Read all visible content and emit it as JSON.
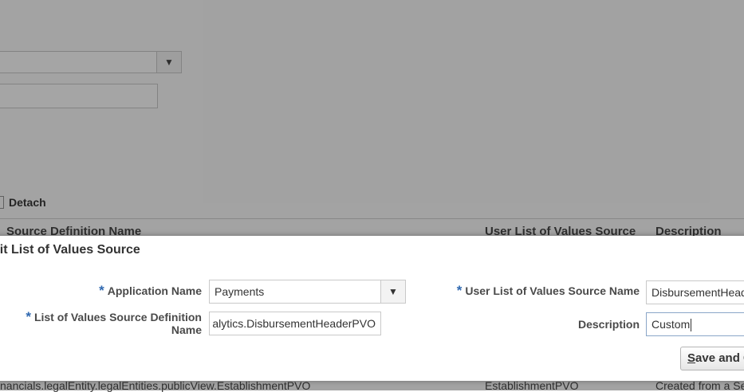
{
  "background": {
    "detach_label": "Detach",
    "table_headers": [
      "Source Definition Name",
      "User List of Values Source",
      "Description"
    ],
    "row": {
      "col1": "nancials.legalEntity.legalEntities.publicView.EstablishmentPVO",
      "col2": "EstablishmentPVO",
      "col3": "Created from a Se"
    }
  },
  "dialog": {
    "title": "dit List of Values Source",
    "required_marker": "*",
    "application_name": {
      "label": "Application Name",
      "value": "Payments"
    },
    "lov_source_definition": {
      "label_line1": "List of Values Source Definition",
      "label_line2": "Name",
      "value": "alytics.DisbursementHeaderPVO"
    },
    "user_lov_source_name": {
      "label": "User List of Values Source Name",
      "value": "DisbursementHead"
    },
    "description": {
      "label": "Description",
      "value": "Custom"
    },
    "save_button": "Save and C"
  },
  "icons": {
    "dropdown": "chevron-down-icon"
  }
}
